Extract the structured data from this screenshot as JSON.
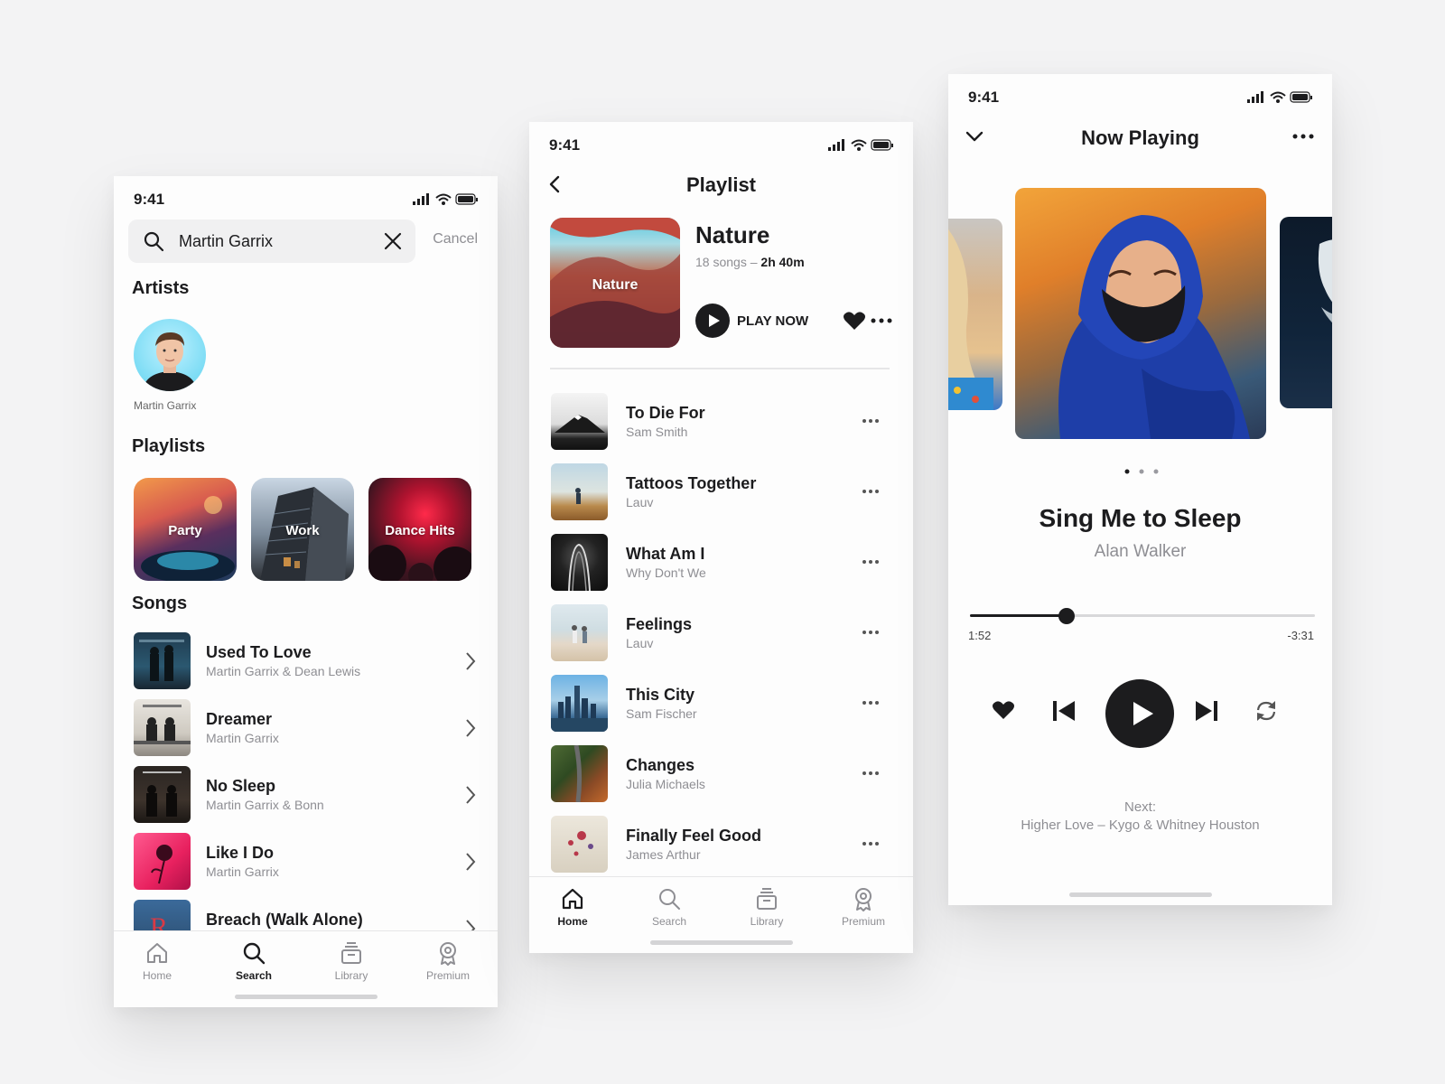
{
  "status": {
    "time": "9:41"
  },
  "search_screen": {
    "query": "Martin Garrix",
    "cancel_label": "Cancel",
    "artists_title": "Artists",
    "artist_name": "Martin Garrix",
    "playlists_title": "Playlists",
    "playlists": [
      "Party",
      "Work",
      "Dance Hits"
    ],
    "songs_title": "Songs",
    "songs": [
      {
        "title": "Used To Love",
        "artist": "Martin Garrix & Dean Lewis"
      },
      {
        "title": "Dreamer",
        "artist": "Martin Garrix"
      },
      {
        "title": "No Sleep",
        "artist": "Martin Garrix & Bonn"
      },
      {
        "title": "Like I Do",
        "artist": "Martin Garrix"
      },
      {
        "title": "Breach (Walk Alone)",
        "artist": ""
      }
    ],
    "active_tab": "Search"
  },
  "tabs": [
    "Home",
    "Search",
    "Library",
    "Premium"
  ],
  "playlist_screen": {
    "title": "Playlist",
    "cover_label": "Nature",
    "name": "Nature",
    "song_count": "18 songs",
    "separator": "–",
    "duration": "2h 40m",
    "play_label": "PLAY NOW",
    "tracks": [
      {
        "title": "To Die For",
        "artist": "Sam Smith"
      },
      {
        "title": "Tattoos Together",
        "artist": "Lauv"
      },
      {
        "title": "What Am I",
        "artist": "Why Don't We"
      },
      {
        "title": "Feelings",
        "artist": "Lauv"
      },
      {
        "title": "This City",
        "artist": "Sam Fischer"
      },
      {
        "title": "Changes",
        "artist": "Julia Michaels"
      },
      {
        "title": "Finally Feel Good",
        "artist": "James Arthur"
      }
    ],
    "active_tab": "Home"
  },
  "player_screen": {
    "title": "Now Playing",
    "song": "Sing Me to Sleep",
    "artist": "Alan Walker",
    "elapsed": "1:52",
    "remaining": "-3:31",
    "progress": 0.28,
    "pager_total": 3,
    "pager_active": 0,
    "next_label": "Next:",
    "next_song": "Higher Love – Kygo & Whitney Houston"
  },
  "colors": {
    "accent": "#1c1c1e",
    "muted": "#8e8e93",
    "background": "#f3f3f4"
  }
}
